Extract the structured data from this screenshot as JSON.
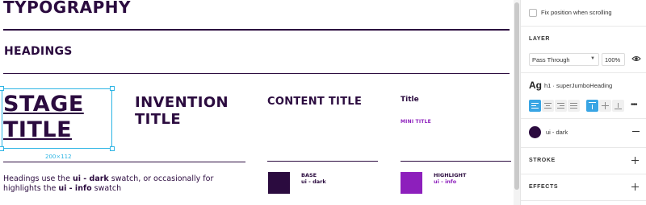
{
  "canvas": {
    "page_title": "TYPOGRAPHY",
    "section_title": "HEADINGS",
    "samples": {
      "stage_title": "STAGE TITLE",
      "invention_title": "INVENTION TITLE",
      "content_title": "CONTENT TITLE",
      "title": "Title",
      "mini_title": "MINI TITLE"
    },
    "selection_size": "200×112",
    "description": {
      "part1": "Headings use the ",
      "bold1": "ui - dark",
      "part2": " swatch, or occasionally for highlights the ",
      "bold2": "ui - info",
      "part3": " swatch"
    },
    "swatches": [
      {
        "name": "BASE",
        "value": "ui - dark",
        "color": "#2b0b3f"
      },
      {
        "name": "HIGHLIGHT",
        "value": "ui - info",
        "color": "#8d1fbc"
      }
    ]
  },
  "panel": {
    "fix_position_label": "Fix position when scrolling",
    "layer": {
      "title": "LAYER",
      "blend_mode": "Pass Through",
      "opacity": "100%"
    },
    "text_style": {
      "glyph": "Ag",
      "name": "h1 · superJumboHeading"
    },
    "fill": {
      "name": "ui - dark",
      "color": "#2b0b3f"
    },
    "stroke_title": "STROKE",
    "effects_title": "EFFECTS"
  },
  "colors": {
    "ui_dark": "#2b0b3f",
    "ui_info": "#8d1fbc",
    "selection": "#2cb4e4",
    "accent_blue": "#39a5e4"
  },
  "icons": [
    "checkbox-icon",
    "chevron-down-icon",
    "eye-icon",
    "align-left-icon",
    "align-center-icon",
    "align-right-icon",
    "align-justify-icon",
    "align-top-icon",
    "align-middle-icon",
    "align-bottom-icon",
    "more-icon",
    "minus-icon",
    "plus-icon"
  ]
}
